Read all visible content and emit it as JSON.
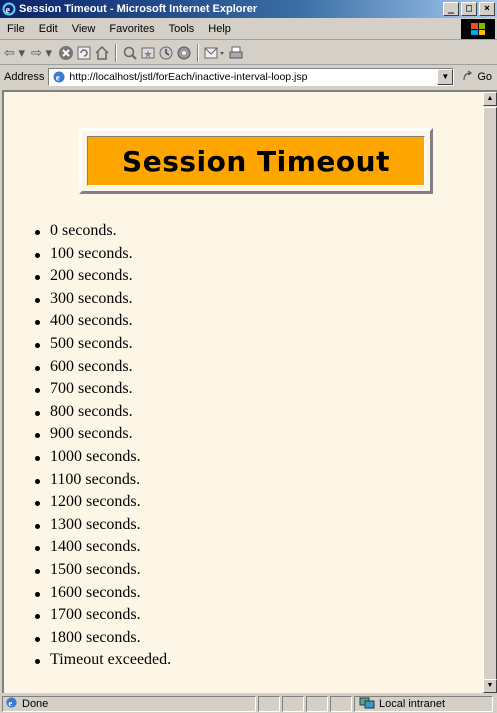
{
  "window": {
    "title": "Session Timeout - Microsoft Internet Explorer",
    "buttons": {
      "minimize": "_",
      "maximize": "□",
      "close": "×"
    }
  },
  "menu": [
    "File",
    "Edit",
    "View",
    "Favorites",
    "Tools",
    "Help"
  ],
  "toolbar": {
    "icons": [
      "back-arrow-icon",
      "forward-arrow-icon",
      "stop-icon",
      "refresh-icon",
      "home-icon",
      "search-icon",
      "favorites-icon",
      "history-icon",
      "mail-icon",
      "print-icon"
    ]
  },
  "address": {
    "label": "Address",
    "url": "http://localhost/jstl/forEach/inactive-interval-loop.jsp",
    "go_label": "Go"
  },
  "page": {
    "heading": "Session Timeout",
    "heading_bg": "#ffa500",
    "background": "#fdf5e6",
    "items": [
      "0 seconds.",
      "100 seconds.",
      "200 seconds.",
      "300 seconds.",
      "400 seconds.",
      "500 seconds.",
      "600 seconds.",
      "700 seconds.",
      "800 seconds.",
      "900 seconds.",
      "1000 seconds.",
      "1100 seconds.",
      "1200 seconds.",
      "1300 seconds.",
      "1400 seconds.",
      "1500 seconds.",
      "1600 seconds.",
      "1700 seconds.",
      "1800 seconds.",
      "Timeout exceeded."
    ]
  },
  "status": {
    "text": "Done",
    "zone": "Local intranet"
  }
}
